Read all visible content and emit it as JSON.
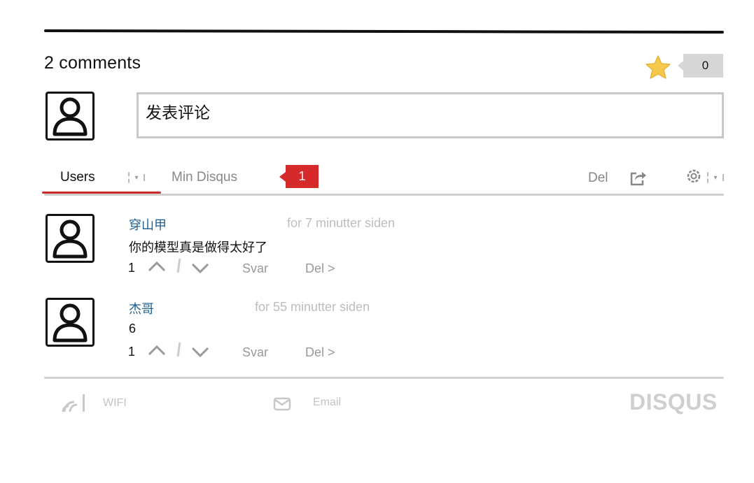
{
  "header": {
    "comment_count": "2 comments",
    "favorite_count": "0"
  },
  "composer": {
    "placeholder": "发表评论"
  },
  "tabs": {
    "users": "Users",
    "mine": "Min Disqus",
    "notification_count": "1",
    "share": "Del"
  },
  "comments": [
    {
      "author": "穿山甲",
      "time": "for 7 minutter siden",
      "text": "你的模型真是做得太好了",
      "votes": "1",
      "reply": "Svar",
      "share": "Del >"
    },
    {
      "author": "杰哥",
      "time": "for 55 minutter siden",
      "text": "6",
      "votes": "1",
      "reply": "Svar",
      "share": "Del >"
    }
  ],
  "footer": {
    "wifi": "WIFI",
    "email": "Email",
    "logo": "DISQUS"
  },
  "colors": {
    "accent": "#d62a2a",
    "star": "#f6c84c",
    "author_link": "#1f5f8f"
  }
}
